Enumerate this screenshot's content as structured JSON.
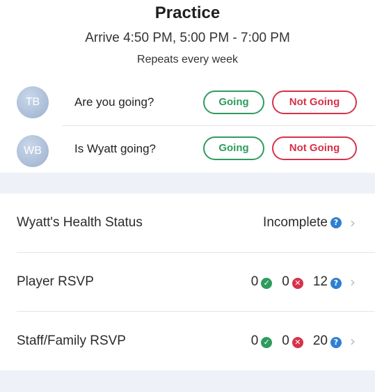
{
  "event": {
    "title": "Practice",
    "time": "Arrive 4:50 PM, 5:00 PM - 7:00 PM",
    "repeat": "Repeats every week"
  },
  "rsvp": [
    {
      "initials": "TB",
      "question": "Are you going?",
      "going_label": "Going",
      "not_going_label": "Not Going"
    },
    {
      "initials": "WB",
      "question": "Is Wyatt going?",
      "going_label": "Going",
      "not_going_label": "Not Going"
    }
  ],
  "rows": {
    "health": {
      "label": "Wyatt's Health Status",
      "status": "Incomplete"
    },
    "player": {
      "label": "Player RSVP",
      "yes": "0",
      "no": "0",
      "unknown": "12"
    },
    "staff": {
      "label": "Staff/Family RSVP",
      "yes": "0",
      "no": "0",
      "unknown": "20"
    }
  },
  "colors": {
    "going": "#2e9c5e",
    "not_going": "#d6324a",
    "unknown": "#2f7fd0",
    "band": "#eef2f8",
    "avatar": "#a9bcd6"
  },
  "icons": {
    "check": "✓",
    "x": "✕",
    "question": "?",
    "chevron": "›"
  }
}
